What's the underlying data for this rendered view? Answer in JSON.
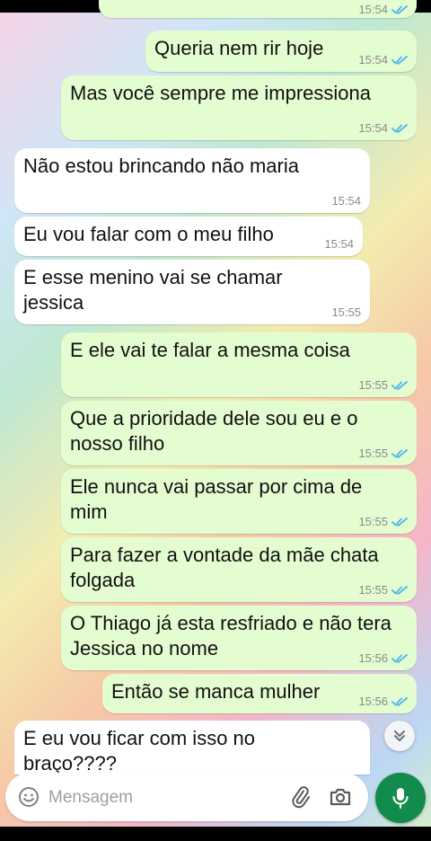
{
  "messages": [
    {
      "text": "Queria nem rir hoje",
      "time": "15:54",
      "direction": "out",
      "read": true
    },
    {
      "text": "Mas você sempre me impressiona",
      "time": "15:54",
      "direction": "out",
      "read": true
    },
    {
      "text": "Não estou brincando não maria",
      "time": "15:54",
      "direction": "in"
    },
    {
      "text": "Eu vou falar com o meu filho",
      "time": "15:54",
      "direction": "in"
    },
    {
      "text": "E esse menino vai se chamar\njessica",
      "time": "15:55",
      "direction": "in"
    },
    {
      "text": "E ele vai te falar a mesma coisa",
      "time": "15:55",
      "direction": "out",
      "read": true
    },
    {
      "text": "Que a prioridade dele sou eu e o\nnosso filho",
      "time": "15:55",
      "direction": "out",
      "read": true
    },
    {
      "text": "Ele nunca vai passar por cima de\nmim",
      "time": "15:55",
      "direction": "out",
      "read": true
    },
    {
      "text": "Para fazer a vontade da mãe chata\nfolgada",
      "time": "15:55",
      "direction": "out",
      "read": true
    },
    {
      "text": "O Thiago já esta resfriado e não tera\nJessica no nome",
      "time": "15:56",
      "direction": "out",
      "read": true
    },
    {
      "text": "Então se manca mulher",
      "time": "15:56",
      "direction": "out",
      "read": true
    },
    {
      "text": "E eu vou ficar com isso no\nbraço????",
      "time": "",
      "direction": "in"
    }
  ],
  "previous_time": "15:54",
  "composer": {
    "placeholder": "Mensagem"
  },
  "icons": {
    "emoji": "emoji-icon",
    "attach": "paperclip-icon",
    "camera": "camera-icon",
    "mic": "microphone-icon",
    "scroll": "double-chevron-down-icon"
  },
  "colors": {
    "outgoing_bubble": "#e4fdd0",
    "incoming_bubble": "#ffffff",
    "read_ticks": "#4fb6ec",
    "mic_button": "#128c4c"
  }
}
